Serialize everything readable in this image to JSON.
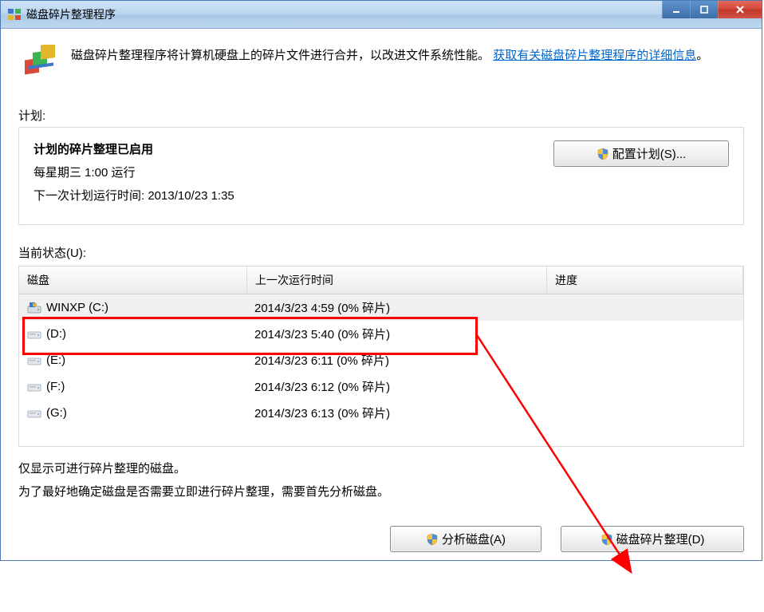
{
  "window": {
    "title": "磁盘碎片整理程序"
  },
  "intro": {
    "text_before_link": "磁盘碎片整理程序将计算机硬盘上的碎片文件进行合并，以改进文件系统性能。",
    "link_text": "获取有关磁盘碎片整理程序的详细信息",
    "period": "。"
  },
  "schedule": {
    "section_label": "计划:",
    "enabled_text": "计划的碎片整理已启用",
    "run_time": "每星期三  1:00 运行",
    "next_run": "下一次计划运行时间: 2013/10/23 1:35",
    "configure_button": "配置计划(S)..."
  },
  "status": {
    "section_label": "当前状态(U):"
  },
  "columns": {
    "disk": "磁盘",
    "last_run": "上一次运行时间",
    "progress": "进度"
  },
  "disks": [
    {
      "icon": "os",
      "name": "WINXP (C:)",
      "last_run": "2014/3/23 4:59 (0% 碎片)",
      "selected": true
    },
    {
      "icon": "drive",
      "name": "(D:)",
      "last_run": "2014/3/23 5:40 (0% 碎片)",
      "selected": false
    },
    {
      "icon": "drive",
      "name": "(E:)",
      "last_run": "2014/3/23 6:11 (0% 碎片)",
      "selected": false
    },
    {
      "icon": "drive",
      "name": "(F:)",
      "last_run": "2014/3/23 6:12 (0% 碎片)",
      "selected": false
    },
    {
      "icon": "drive",
      "name": "(G:)",
      "last_run": "2014/3/23 6:13 (0% 碎片)",
      "selected": false
    }
  ],
  "notes": {
    "line1": "仅显示可进行碎片整理的磁盘。",
    "line2": "为了最好地确定磁盘是否需要立即进行碎片整理，需要首先分析磁盘。"
  },
  "buttons": {
    "analyze": "分析磁盘(A)",
    "defrag": "磁盘碎片整理(D)"
  }
}
